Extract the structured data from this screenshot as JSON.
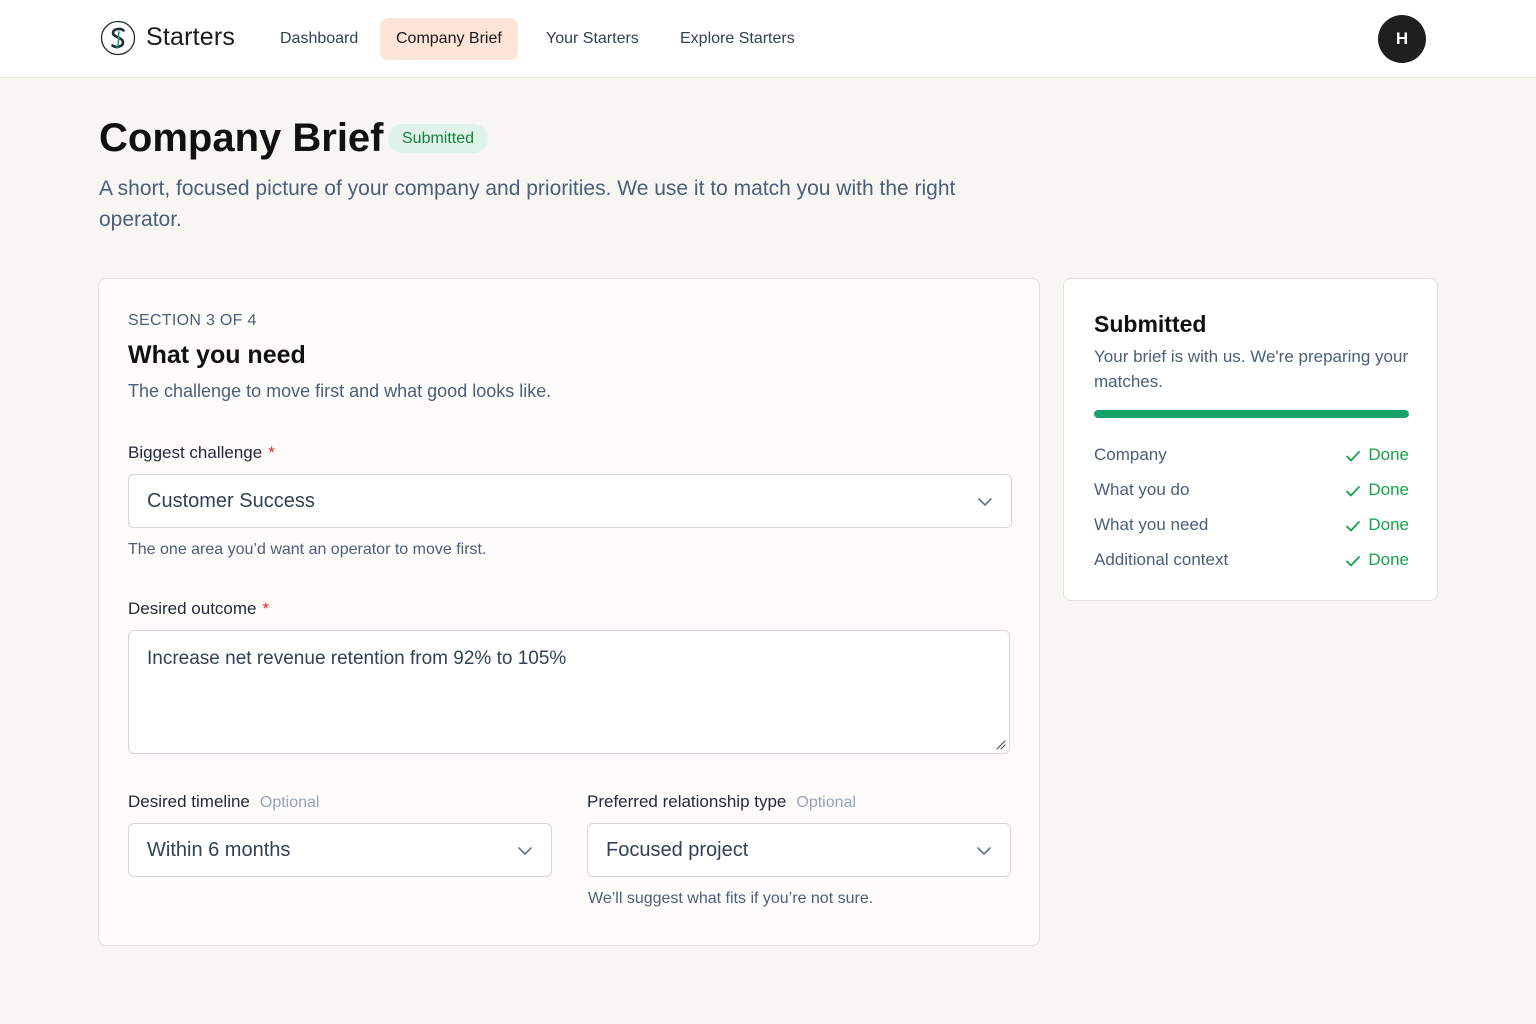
{
  "app": {
    "brand": "Starters",
    "avatar_initial": "H",
    "accent_color": "#fce4d8",
    "success_color": "#16a36a"
  },
  "nav": {
    "items": [
      {
        "label": "Dashboard",
        "active": false
      },
      {
        "label": "Company Brief",
        "active": true
      },
      {
        "label": "Your Starters",
        "active": false
      },
      {
        "label": "Explore Starters",
        "active": false
      }
    ]
  },
  "header": {
    "title": "Company Brief",
    "badge": "Submitted",
    "subtitle": "A short, focused picture of your company and priorities. We use it to match you with the right operator."
  },
  "section": {
    "kicker": "SECTION 3 OF 4",
    "title": "What you need",
    "description": "The challenge to move first and what good looks like."
  },
  "fields": {
    "challenge": {
      "label": "Biggest challenge",
      "required_mark": "*",
      "value": "Customer Success",
      "help": "The one area you’d want an operator to move first."
    },
    "outcome": {
      "label": "Desired outcome",
      "required_mark": "*",
      "value": "Increase net revenue retention from 92% to 105%"
    },
    "timeline": {
      "label": "Desired timeline",
      "optional_label": "Optional",
      "value": "Within 6 months"
    },
    "relationship": {
      "label": "Preferred relationship type",
      "optional_label": "Optional",
      "value": "Focused project",
      "help": "We’ll suggest what fits if you’re not sure."
    }
  },
  "status": {
    "title": "Submitted",
    "text": "Your brief is with us. We're preparing your matches.",
    "progress": 1.0,
    "steps": [
      {
        "label": "Company",
        "status": "Done",
        "icon": "check-icon"
      },
      {
        "label": "What you do",
        "status": "Done",
        "icon": "check-icon"
      },
      {
        "label": "What you need",
        "status": "Done",
        "icon": "check-icon"
      },
      {
        "label": "Additional context",
        "status": "Done",
        "icon": "check-icon"
      }
    ]
  }
}
